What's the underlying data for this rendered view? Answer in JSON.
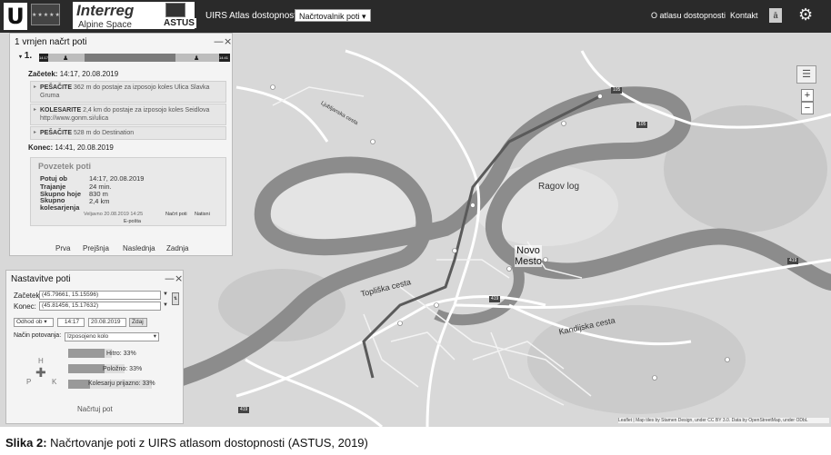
{
  "header": {
    "logo_letter": "U",
    "interreg_name": "Interreg",
    "interreg_program": "Alpine Space",
    "project_name": "ASTUS",
    "app_title": "UIRS Atlas dostopnosti",
    "planner_select": "Načrtovalnik poti",
    "nav_about": "O atlasu dostopnosti",
    "nav_contact": "Kontakt",
    "lang_icon": "translate-icon",
    "settings_icon": "gear-icon"
  },
  "map": {
    "town_label": "Novo Mesto",
    "forest_label": "Ragov log",
    "street_1": "Topliška cesta",
    "street_2": "Kandijska cesta",
    "street_3": "Ljubljanska cesta",
    "road_badges": [
      "105",
      "105",
      "419",
      "419",
      "419"
    ],
    "zoom_in": "+",
    "zoom_out": "−",
    "attribution": "Leaflet | Map tiles by Stamen Design, under CC BY 3.0. Data by OpenStreetMap, under ODbL",
    "colors": {
      "land": "#d9d9d9",
      "river": "#8c8c8c",
      "road": "#ffffff",
      "route": "#5a5a5a"
    }
  },
  "route_panel": {
    "title": "1 vrnjen načrt poti",
    "collapse": "—",
    "close": "×",
    "route_number": "1.",
    "bar_start_tag": "14:17",
    "bar_end_tag": "14:41",
    "start_label": "Začetek:",
    "start_time": "14:17, 20.08.2019",
    "steps": [
      {
        "mode": "PEŠAČITE",
        "text": "362 m do postaje za izposojo koles Ulica Slavka Gruma"
      },
      {
        "mode": "KOLESARITE",
        "text": "2,4 km do postaje za izposojo koles Seidlova http://www.gonm.si/ulica"
      },
      {
        "mode": "PEŠAČITE",
        "text": "528 m do Destination"
      }
    ],
    "end_label": "Konec:",
    "end_time": "14:41, 20.08.2019",
    "summary": {
      "title": "Povzetek poti",
      "rows": [
        {
          "label": "Potuj ob",
          "value": "14:17, 20.08.2019"
        },
        {
          "label": "Trajanje",
          "value": "24 min."
        },
        {
          "label": "Skupno hoje",
          "value": "830 m"
        },
        {
          "label": "Skupno kolesarjenja",
          "value": "2,4 km"
        }
      ],
      "generated": "Veljavno 20.08.2019 14:25",
      "link_plan": "Načrt poti",
      "link_print": "Natisni",
      "link_email": "E-pošta"
    },
    "pager": {
      "first": "Prva",
      "prev": "Prejšnja",
      "next": "Naslednja",
      "last": "Zadnja"
    }
  },
  "settings_panel": {
    "title": "Nastavitve poti",
    "collapse": "—",
    "close": "×",
    "start_label": "Začetek:",
    "start_value": "(45.79661, 15.15596)",
    "end_label": "Konec:",
    "end_value": "(45.81456, 15.17632)",
    "depart_select": "Odhod ob",
    "depart_time": "14:17",
    "depart_date": "20.08.2019",
    "now_button": "Zdaj",
    "mode_label": "Način potovanja:",
    "mode_value": "Izposojeno kolo",
    "compass": {
      "n": "H",
      "w": "P",
      "e": "K"
    },
    "sliders": [
      {
        "label": "Hitro",
        "percent": 33
      },
      {
        "label": "Položno",
        "percent": 33
      },
      {
        "label": "Kolesarju prijazno",
        "percent": 33
      }
    ],
    "slider_text": [
      "Hitro: 33%",
      "Položno: 33%",
      "Kolesarju prijazno: 33%"
    ],
    "plan_button": "Načrtuj pot"
  },
  "caption": {
    "label": "Slika 2:",
    "text": "Načrtovanje poti z UIRS atlasom dostopnosti (ASTUS, 2019)"
  }
}
